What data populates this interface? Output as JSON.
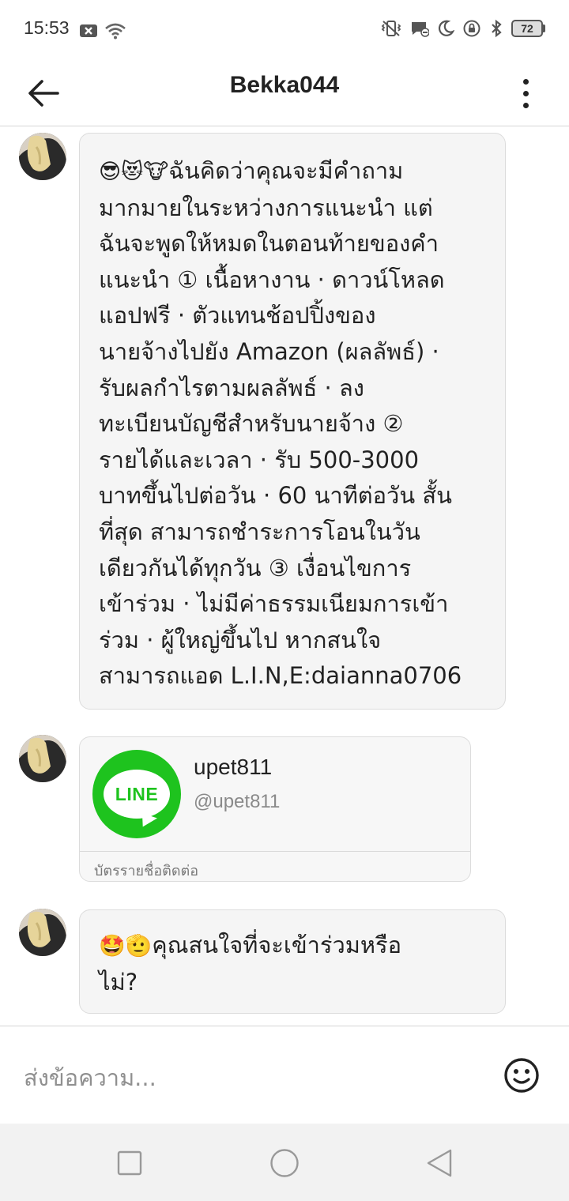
{
  "status_bar": {
    "time": "15:53",
    "battery": "72"
  },
  "header": {
    "title": "Bekka044"
  },
  "messages": [
    {
      "emojis": "😎😻🐮",
      "text": "ฉันคิดว่าคุณจะมีคำถาม\nมากมายในระหว่างการแนะนำ แต่\nฉันจะพูดให้หมดในตอนท้ายของคำ\nแนะนำ ① เนื้อหางาน · ดาวน์โหลด\nแอปฟรี · ตัวแทนช้อปปิ้งของ\nนายจ้างไปยัง Amazon (ผลลัพธ์) ·\nรับผลกำไรตามผลลัพธ์ · ลง\nทะเบียนบัญชีสำหรับนายจ้าง ②\nรายได้และเวลา · รับ 500-3000\nบาทขึ้นไปต่อวัน · 60 นาทีต่อวัน สั้น\nที่สุด สามารถชำระการโอนในวัน\nเดียวกันได้ทุกวัน ③ เงื่อนไขการ\nเข้าร่วม · ไม่มีค่าธรรมเนียมการเข้า\nร่วม · ผู้ใหญ่ขึ้นไป หากสนใจ\nสามารถแอด L.I.N,E:daianna0706"
    },
    {
      "contact_card": {
        "logo_text": "LINE",
        "name": "upet811",
        "handle": "@upet811",
        "footer": "บัตรรายชื่อติดต่อ"
      }
    },
    {
      "emojis": "🤩🫡",
      "text": "คุณสนใจที่จะเข้าร่วมหรือ\nไม่?"
    }
  ],
  "composer": {
    "placeholder": "ส่งข้อความ..."
  },
  "icons": {
    "back": "arrow-left-icon",
    "more": "more-vertical-icon",
    "emoji": "smiley-icon",
    "nav_recents": "square-icon",
    "nav_home": "circle-icon",
    "nav_back": "triangle-back-icon"
  },
  "colors": {
    "line_green": "#1ec31e",
    "bubble_bg": "#f5f5f5"
  }
}
